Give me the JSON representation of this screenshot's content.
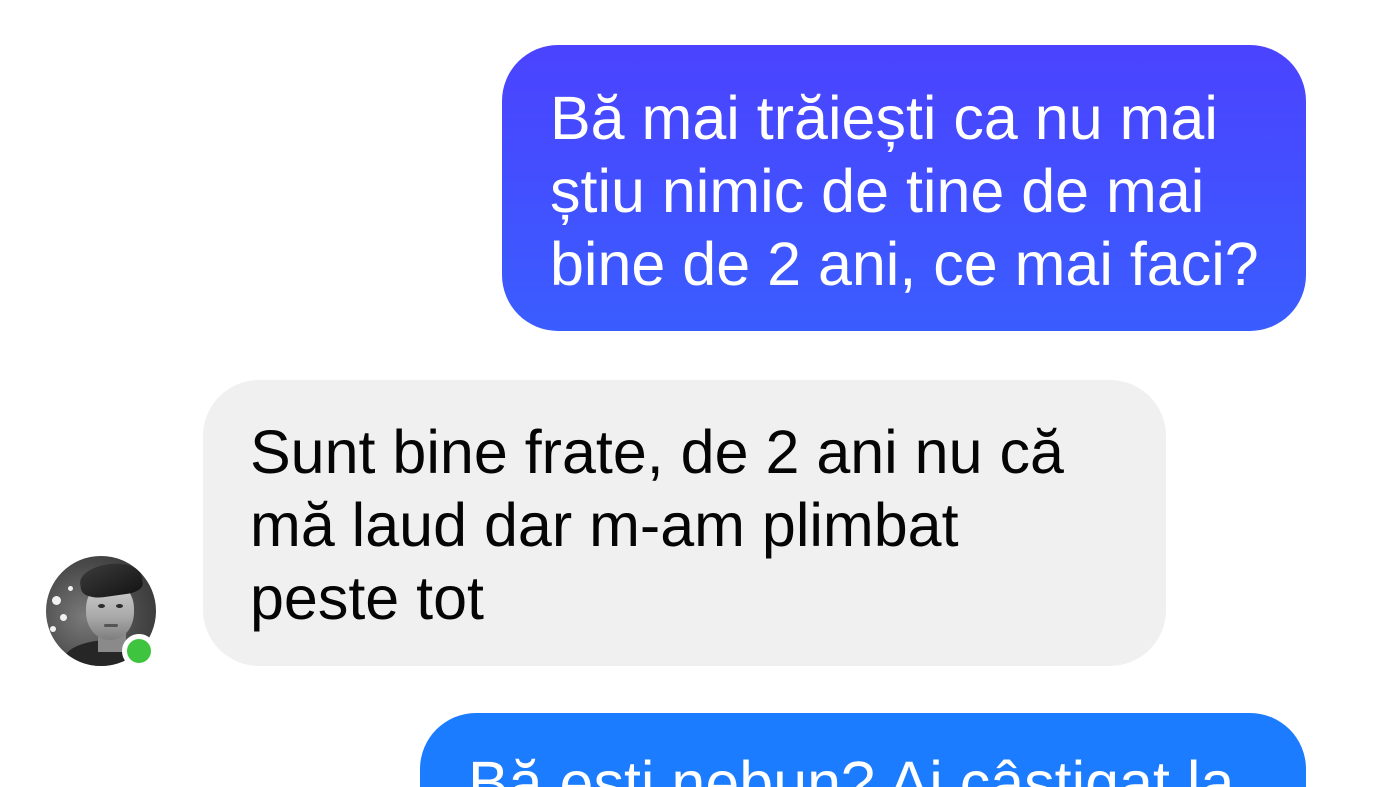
{
  "conversation": {
    "messages": [
      {
        "direction": "outgoing",
        "lines": [
          "Bă mai trăiești ca nu mai",
          "știu nimic de tine de mai",
          "bine de 2 ani, ce mai faci?"
        ]
      },
      {
        "direction": "incoming",
        "lines": [
          "Sunt bine frate, de 2 ani nu că",
          "mă laud dar m-am plimbat",
          "peste tot"
        ]
      },
      {
        "direction": "outgoing",
        "lines": [
          "Bă ești nebun? Ai câștigat la"
        ]
      }
    ],
    "contact": {
      "avatar_icon": "contact-avatar",
      "presence_icon": "online-status-dot-icon"
    }
  },
  "colors": {
    "outgoing_gradient_top": "#4b43ff",
    "outgoing_gradient_bottom": "#3a5dff",
    "outgoing_solid": "#1c7cff",
    "incoming_bubble": "#f0f0f0",
    "incoming_text": "#050505",
    "outgoing_text": "#ffffff",
    "presence": "#3fc43f"
  }
}
